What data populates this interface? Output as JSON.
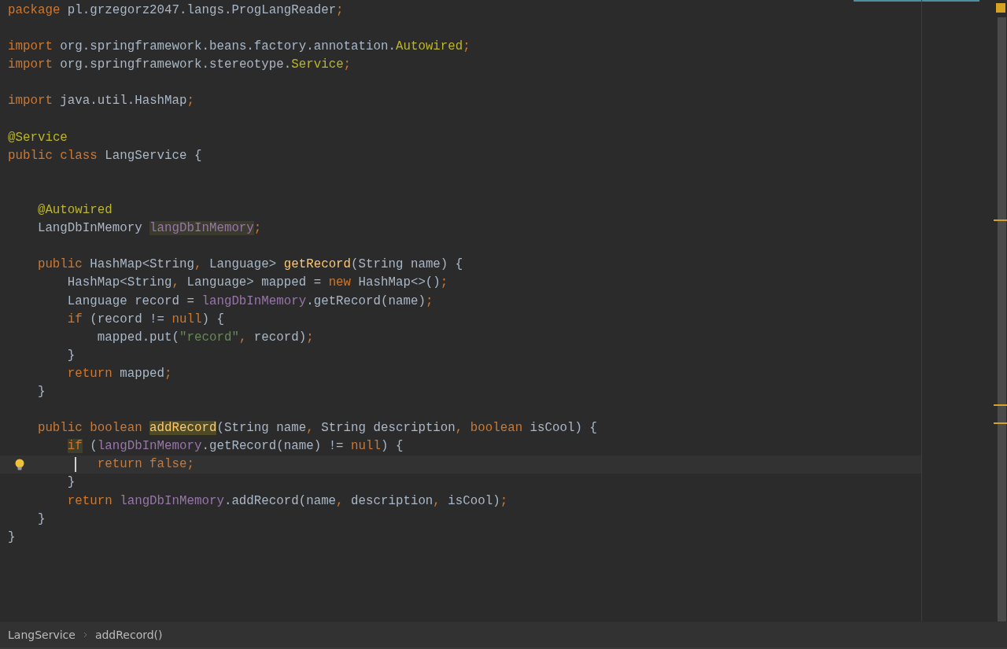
{
  "editor": {
    "lines": [
      {
        "current": false,
        "tokens": [
          {
            "kind": "keyword",
            "text": "package",
            "highlighted": false
          },
          {
            "kind": "plain",
            "text": " pl.grzegorz2047.langs.ProgLangReader",
            "highlighted": false
          },
          {
            "kind": "keyword",
            "text": ";",
            "highlighted": false
          }
        ]
      },
      {
        "current": false
      },
      {
        "current": false,
        "tokens": [
          {
            "kind": "keyword",
            "text": "import",
            "highlighted": false
          },
          {
            "kind": "plain",
            "text": " org.springframework.beans.factory.annotation.",
            "highlighted": false
          },
          {
            "kind": "annotation",
            "text": "Autowired",
            "highlighted": false
          },
          {
            "kind": "keyword",
            "text": ";",
            "highlighted": false
          }
        ]
      },
      {
        "current": false,
        "tokens": [
          {
            "kind": "keyword",
            "text": "import",
            "highlighted": false
          },
          {
            "kind": "plain",
            "text": " org.springframework.stereotype.",
            "highlighted": false
          },
          {
            "kind": "annotation",
            "text": "Service",
            "highlighted": false
          },
          {
            "kind": "keyword",
            "text": ";",
            "highlighted": false
          }
        ]
      },
      {
        "current": false
      },
      {
        "current": false,
        "tokens": [
          {
            "kind": "keyword",
            "text": "import",
            "highlighted": false
          },
          {
            "kind": "plain",
            "text": " java.util.HashMap",
            "highlighted": false
          },
          {
            "kind": "keyword",
            "text": ";",
            "highlighted": false
          }
        ]
      },
      {
        "current": false
      },
      {
        "current": false,
        "tokens": [
          {
            "kind": "annotation",
            "text": "@Service",
            "highlighted": false
          }
        ]
      },
      {
        "current": false,
        "tokens": [
          {
            "kind": "keyword",
            "text": "public class",
            "highlighted": false
          },
          {
            "kind": "plain",
            "text": " LangService {",
            "highlighted": false
          }
        ]
      },
      {
        "current": false
      },
      {
        "current": false
      },
      {
        "current": false,
        "tokens": [
          {
            "kind": "annotation",
            "text": "@Autowired",
            "highlighted": false
          }
        ]
      },
      {
        "current": false,
        "tokens": [
          {
            "kind": "plain",
            "text": "LangDbInMemory ",
            "highlighted": false
          },
          {
            "kind": "field",
            "text": "langDbInMemory",
            "highlighted": true
          },
          {
            "kind": "keyword",
            "text": ";",
            "highlighted": false
          }
        ]
      },
      {
        "current": false
      },
      {
        "current": false,
        "tokens": [
          {
            "kind": "keyword",
            "text": "public",
            "highlighted": false
          },
          {
            "kind": "plain",
            "text": " HashMap<String",
            "highlighted": false
          },
          {
            "kind": "keyword",
            "text": ",",
            "highlighted": false
          },
          {
            "kind": "plain",
            "text": " Language> ",
            "highlighted": false
          },
          {
            "kind": "method",
            "text": "getRecord",
            "highlighted": false
          },
          {
            "kind": "plain",
            "text": "(String name) {",
            "highlighted": false
          }
        ]
      },
      {
        "current": false,
        "tokens": [
          {
            "kind": "plain",
            "text": "HashMap<String",
            "highlighted": false
          },
          {
            "kind": "keyword",
            "text": ",",
            "highlighted": false
          },
          {
            "kind": "plain",
            "text": " Language> mapped = ",
            "highlighted": false
          },
          {
            "kind": "keyword",
            "text": "new",
            "highlighted": false
          },
          {
            "kind": "plain",
            "text": " HashMap<>()",
            "highlighted": false
          },
          {
            "kind": "keyword",
            "text": ";",
            "highlighted": false
          }
        ]
      },
      {
        "current": false,
        "tokens": [
          {
            "kind": "plain",
            "text": "Language record = ",
            "highlighted": false
          },
          {
            "kind": "field",
            "text": "langDbInMemory",
            "highlighted": false
          },
          {
            "kind": "plain",
            "text": ".getRecord(name)",
            "highlighted": false
          },
          {
            "kind": "keyword",
            "text": ";",
            "highlighted": false
          }
        ]
      },
      {
        "current": false,
        "tokens": [
          {
            "kind": "keyword",
            "text": "if",
            "highlighted": false
          },
          {
            "kind": "plain",
            "text": " (record != ",
            "highlighted": false
          },
          {
            "kind": "keyword",
            "text": "null",
            "highlighted": false
          },
          {
            "kind": "plain",
            "text": ") {",
            "highlighted": false
          }
        ]
      },
      {
        "current": false,
        "tokens": [
          {
            "kind": "plain",
            "text": "mapped.put(",
            "highlighted": false
          },
          {
            "kind": "string",
            "text": "\"record\"",
            "highlighted": false
          },
          {
            "kind": "keyword",
            "text": ",",
            "highlighted": false
          },
          {
            "kind": "plain",
            "text": " record)",
            "highlighted": false
          },
          {
            "kind": "keyword",
            "text": ";",
            "highlighted": false
          }
        ]
      },
      {
        "current": false,
        "tokens": [
          {
            "kind": "plain",
            "text": "}",
            "highlighted": false
          }
        ]
      },
      {
        "current": false,
        "tokens": [
          {
            "kind": "keyword",
            "text": "return",
            "highlighted": false
          },
          {
            "kind": "plain",
            "text": " mapped",
            "highlighted": false
          },
          {
            "kind": "keyword",
            "text": ";",
            "highlighted": false
          }
        ]
      },
      {
        "current": false,
        "tokens": [
          {
            "kind": "plain",
            "text": "}",
            "highlighted": false
          }
        ]
      },
      {
        "current": false
      },
      {
        "current": false,
        "tokens": [
          {
            "kind": "keyword",
            "text": "public boolean ",
            "highlighted": false
          },
          {
            "kind": "method",
            "text": "addRecord",
            "highlighted": true
          },
          {
            "kind": "plain",
            "text": "(String name",
            "highlighted": false
          },
          {
            "kind": "keyword",
            "text": ",",
            "highlighted": false
          },
          {
            "kind": "plain",
            "text": " String description",
            "highlighted": false
          },
          {
            "kind": "keyword",
            "text": ", boolean",
            "highlighted": false
          },
          {
            "kind": "plain",
            "text": " isCool) {",
            "highlighted": false
          }
        ]
      },
      {
        "current": false,
        "tokens": [
          {
            "kind": "keyword",
            "text": "if",
            "highlighted": true
          },
          {
            "kind": "plain",
            "text": " (",
            "highlighted": false
          },
          {
            "kind": "field",
            "text": "langDbInMemory",
            "highlighted": false
          },
          {
            "kind": "plain",
            "text": ".getRecord(name) != ",
            "highlighted": false
          },
          {
            "kind": "keyword",
            "text": "null",
            "highlighted": false
          },
          {
            "kind": "plain",
            "text": ") {",
            "highlighted": false
          }
        ]
      },
      {
        "current": true,
        "tokens": [
          {
            "kind": "keyword",
            "text": "return false;",
            "highlighted": false
          }
        ]
      },
      {
        "current": false,
        "tokens": [
          {
            "kind": "plain",
            "text": "}",
            "highlighted": false
          }
        ]
      },
      {
        "current": false,
        "tokens": [
          {
            "kind": "keyword",
            "text": "return ",
            "highlighted": false
          },
          {
            "kind": "field",
            "text": "langDbInMemory",
            "highlighted": false
          },
          {
            "kind": "plain",
            "text": ".addRecord(name",
            "highlighted": false
          },
          {
            "kind": "keyword",
            "text": ",",
            "highlighted": false
          },
          {
            "kind": "plain",
            "text": " description",
            "highlighted": false
          },
          {
            "kind": "keyword",
            "text": ",",
            "highlighted": false
          },
          {
            "kind": "plain",
            "text": " isCool)",
            "highlighted": false
          },
          {
            "kind": "keyword",
            "text": ";",
            "highlighted": false
          }
        ]
      },
      {
        "current": false,
        "tokens": [
          {
            "kind": "plain",
            "text": "}",
            "highlighted": false
          }
        ]
      },
      {
        "current": false,
        "tokens": [
          {
            "kind": "plain",
            "text": "}",
            "highlighted": false
          }
        ]
      }
    ]
  },
  "breadcrumbs": [
    "LangService",
    "addRecord()"
  ]
}
